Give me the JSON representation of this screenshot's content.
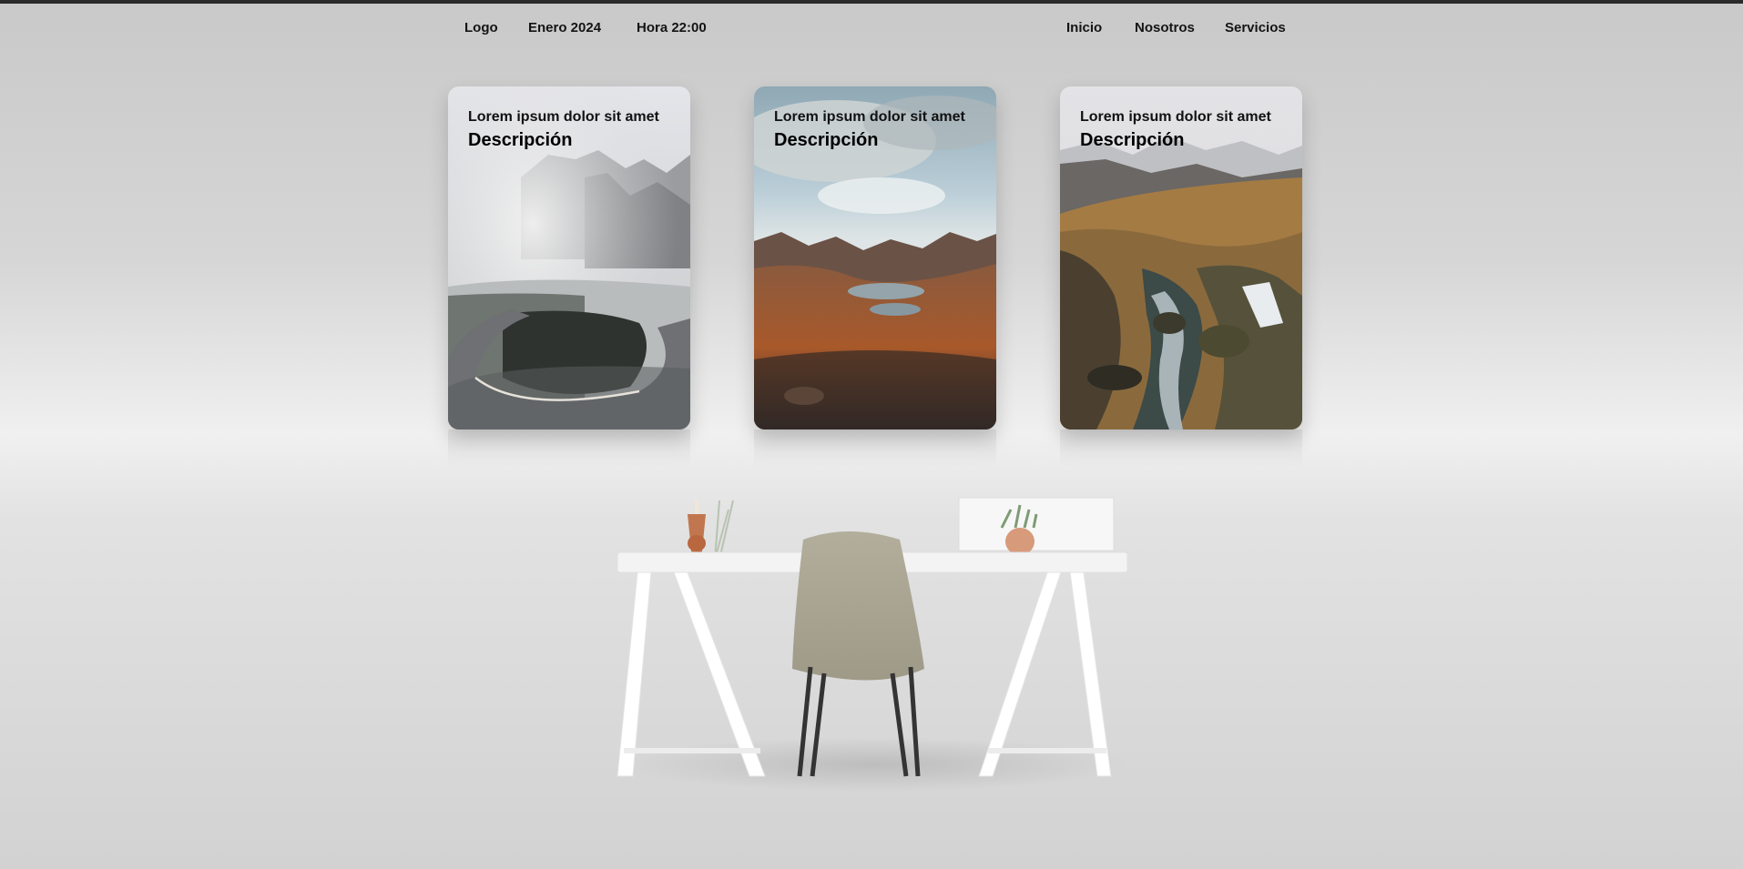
{
  "nav": {
    "left": [
      "Logo",
      "Enero 2024",
      "Hora 22:00"
    ],
    "right": [
      "Inicio",
      "Nosotros",
      "Servicios"
    ]
  },
  "cards": [
    {
      "title": "Lorem ipsum dolor sit amet",
      "description": "Descripción",
      "image": "foggy-mountain-road-photo"
    },
    {
      "title": "Lorem ipsum dolor sit amet",
      "description": "Descripción",
      "image": "mountain-lake-valley-photo"
    },
    {
      "title": "Lorem ipsum dolor sit amet",
      "description": "Descripción",
      "image": "river-waterfall-canyon-photo"
    }
  ],
  "scene": {
    "image": "white-desk-with-chair-photo"
  }
}
